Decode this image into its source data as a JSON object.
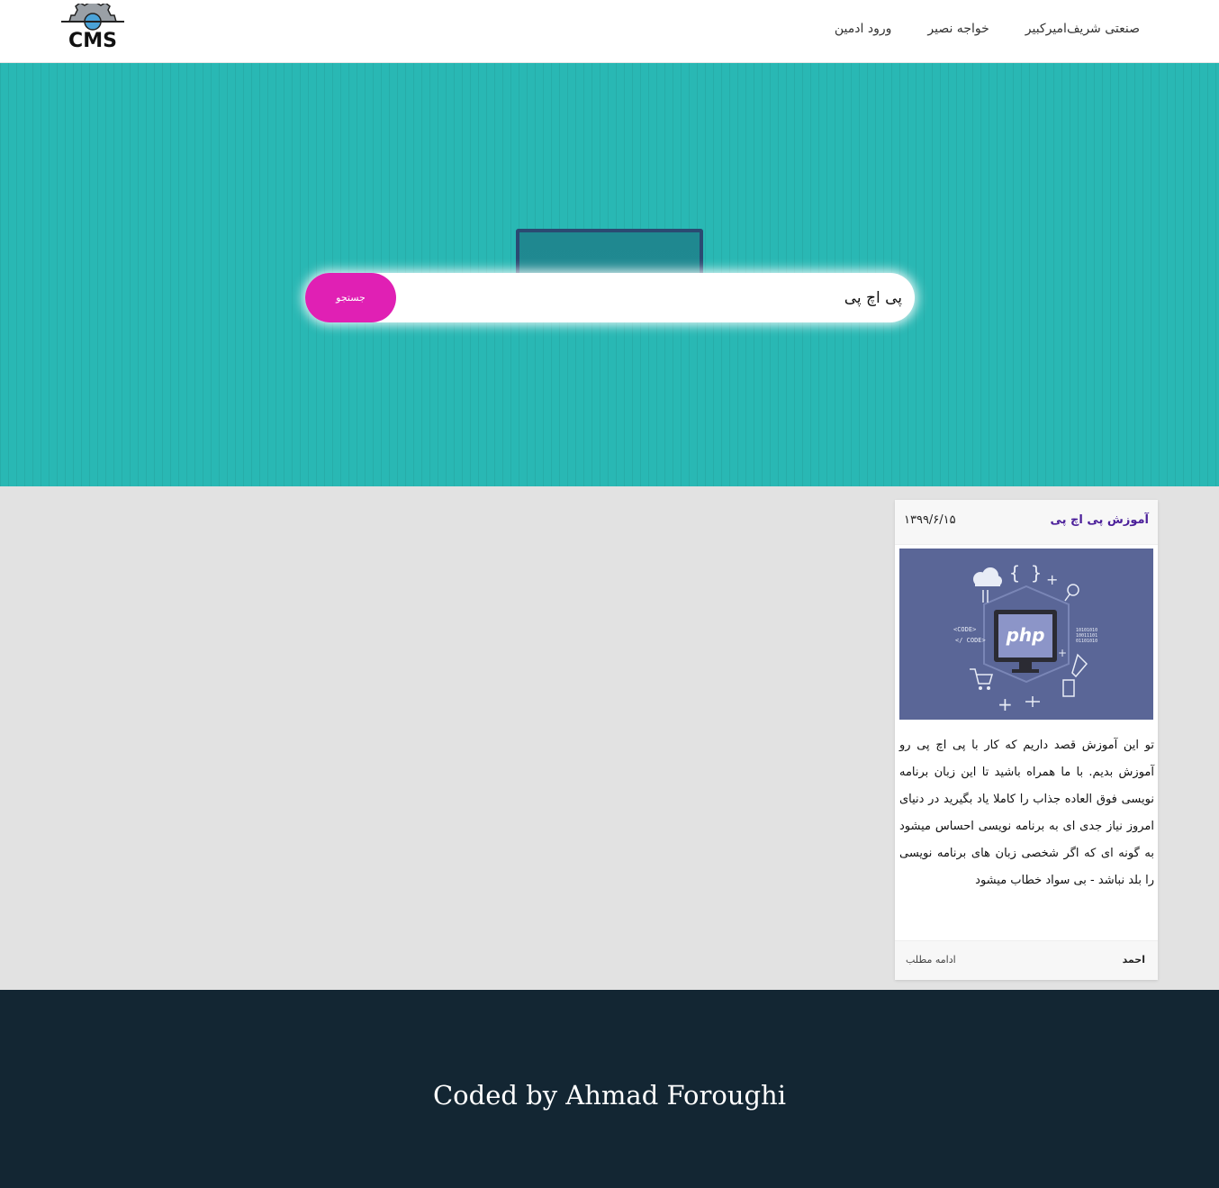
{
  "navbar": {
    "logo_text": "CMS",
    "links": [
      "صنعتی شریف",
      "امیرکبیر",
      "خواجه نصیر",
      "ورود ادمین"
    ]
  },
  "hero": {
    "search_value": "پی اچ پی",
    "search_button": "جستجو"
  },
  "post": {
    "title": "آموزش پی اچ پی",
    "date": "۱۳۹۹/۶/۱۵",
    "image_label": "php",
    "excerpt": "تو این آموزش قصد داریم که کار با پی اچ پی رو آموزش بدیم. با ما همراه باشید تا این زبان برنامه نویسی فوق العاده جذاب را کاملا یاد بگیرید در دنیای امروز نیاز جدی ای به برنامه نویسی احساس میشود به گونه ای که اگر شخصی زبان های برنامه نویسی را بلد نباشد - بی سواد خطاب میشود",
    "author": "احمد",
    "read_more": "ادامه مطلب"
  },
  "footer": {
    "credit": "Coded by Ahmad Foroughi"
  },
  "colors": {
    "hero": "#29b8b4",
    "button": "#e020b4",
    "footer": "#132633",
    "title": "#4b1f9a"
  }
}
